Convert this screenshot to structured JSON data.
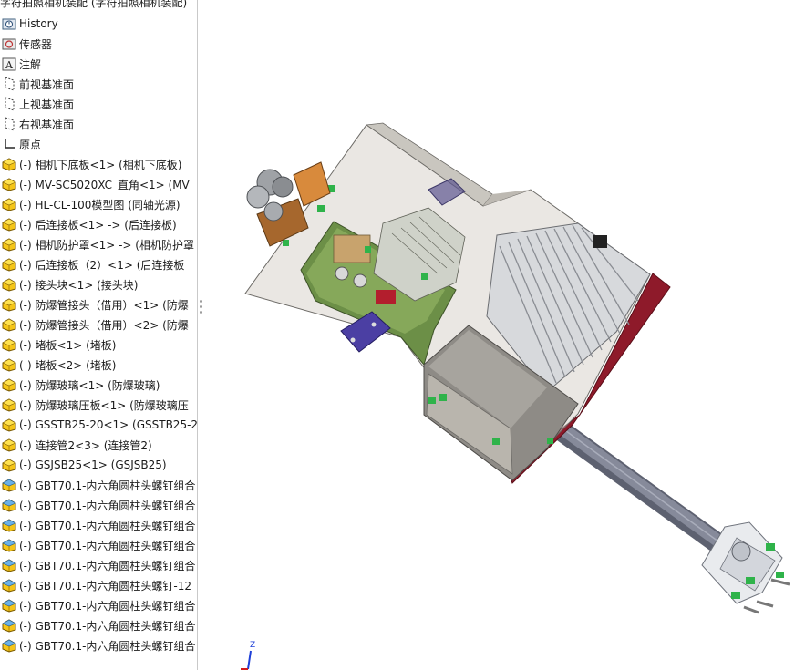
{
  "tree": {
    "title": "字符拍照相机装配 (字符拍照相机装配)",
    "items": [
      {
        "label": "History",
        "icon": "history-icon"
      },
      {
        "label": "传感器",
        "icon": "sensor-icon"
      },
      {
        "label": "注解",
        "icon": "annotation-icon"
      },
      {
        "label": "前视基准面",
        "icon": "plane-icon"
      },
      {
        "label": "上视基准面",
        "icon": "plane-icon"
      },
      {
        "label": "右视基准面",
        "icon": "plane-icon"
      },
      {
        "label": "原点",
        "icon": "origin-icon"
      },
      {
        "label": "(-) 相机下底板<1> (相机下底板)",
        "icon": "part-icon"
      },
      {
        "label": "(-) MV-SC5020XC_直角<1> (MV",
        "icon": "part-icon"
      },
      {
        "label": "(-) HL-CL-100模型图 (同轴光源)",
        "icon": "part-icon"
      },
      {
        "label": "(-) 后连接板<1> -> (后连接板)",
        "icon": "part-icon"
      },
      {
        "label": "(-) 相机防护罩<1> -> (相机防护罩",
        "icon": "part-icon"
      },
      {
        "label": "(-) 后连接板（2）<1> (后连接板",
        "icon": "part-icon"
      },
      {
        "label": "(-) 接头块<1> (接头块)",
        "icon": "part-icon"
      },
      {
        "label": "(-) 防爆管接头（借用）<1> (防爆",
        "icon": "part-icon"
      },
      {
        "label": "(-) 防爆管接头（借用）<2> (防爆",
        "icon": "part-icon"
      },
      {
        "label": "(-) 堵板<1> (堵板)",
        "icon": "part-icon"
      },
      {
        "label": "(-) 堵板<2> (堵板)",
        "icon": "part-icon"
      },
      {
        "label": "(-) 防爆玻璃<1> (防爆玻璃)",
        "icon": "part-icon"
      },
      {
        "label": "(-) 防爆玻璃压板<1> (防爆玻璃压",
        "icon": "part-icon"
      },
      {
        "label": "(-) GSSTB25-20<1> (GSSTB25-2",
        "icon": "part-icon"
      },
      {
        "label": "(-) 连接管2<3> (连接管2)",
        "icon": "part-icon"
      },
      {
        "label": "(-) GSJSB25<1> (GSJSB25)",
        "icon": "part-icon"
      },
      {
        "label": "(-) GBT70.1-内六角圆柱头螺钉组合",
        "icon": "toolbox-part-icon"
      },
      {
        "label": "(-) GBT70.1-内六角圆柱头螺钉组合",
        "icon": "toolbox-part-icon"
      },
      {
        "label": "(-) GBT70.1-内六角圆柱头螺钉组合",
        "icon": "toolbox-part-icon"
      },
      {
        "label": "(-) GBT70.1-内六角圆柱头螺钉组合",
        "icon": "toolbox-part-icon"
      },
      {
        "label": "(-) GBT70.1-内六角圆柱头螺钉组合",
        "icon": "toolbox-part-icon"
      },
      {
        "label": "(-) GBT70.1-内六角圆柱头螺钉-12",
        "icon": "toolbox-part-icon"
      },
      {
        "label": "(-) GBT70.1-内六角圆柱头螺钉组合",
        "icon": "toolbox-part-icon"
      },
      {
        "label": "(-) GBT70.1-内六角圆柱头螺钉组合",
        "icon": "toolbox-part-icon"
      },
      {
        "label": "(-) GBT70.1-内六角圆柱头螺钉组合",
        "icon": "toolbox-part-icon"
      }
    ]
  },
  "triad": {
    "z_label": "Z"
  }
}
